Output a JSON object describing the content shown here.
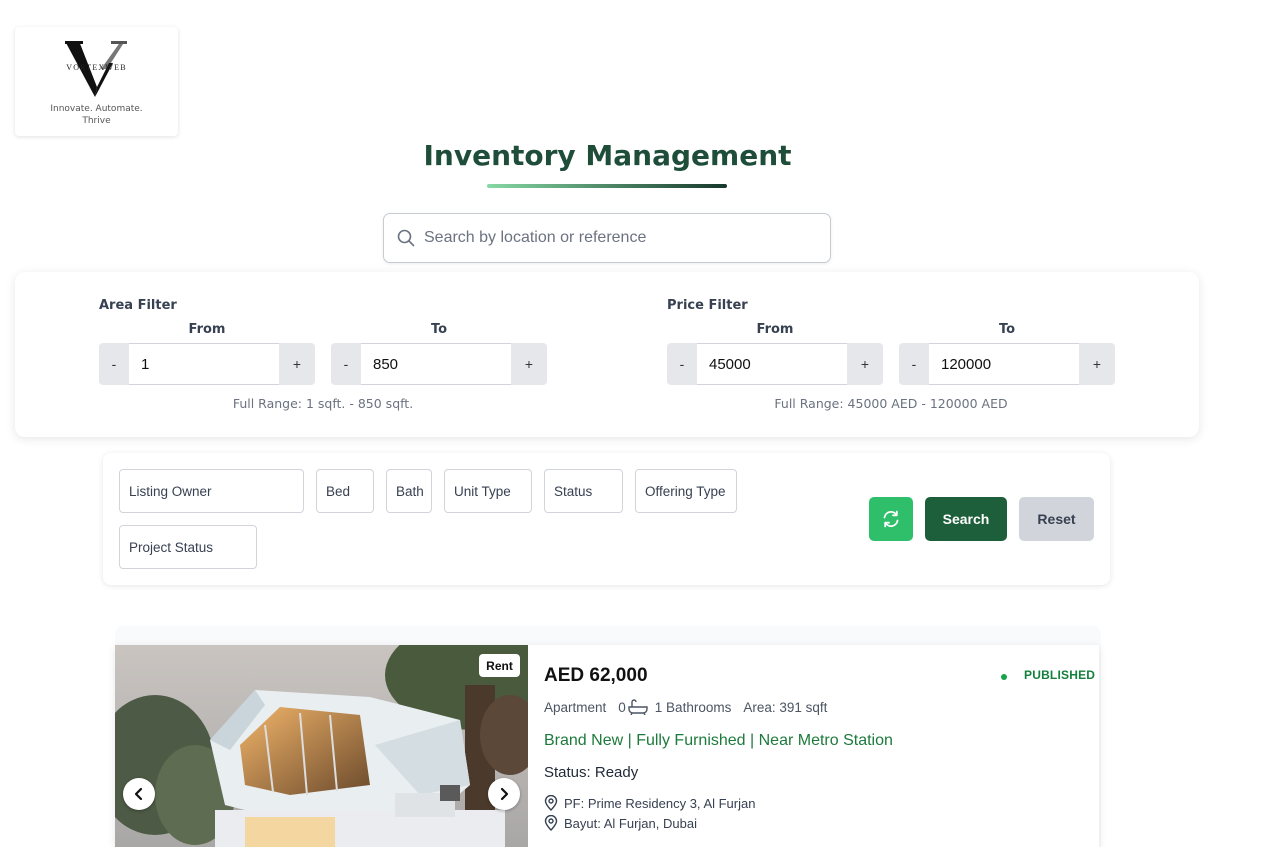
{
  "brand": {
    "name": "VORTEXWEB",
    "tagline": "Innovate. Automate. Thrive"
  },
  "header": {
    "title": "Inventory Management"
  },
  "search": {
    "placeholder": "Search by location or reference",
    "value": ""
  },
  "area_filter": {
    "title": "Area Filter",
    "from_label": "From",
    "to_label": "To",
    "from_value": "1",
    "to_value": "850",
    "range_note": "Full Range: 1 sqft. - 850 sqft."
  },
  "price_filter": {
    "title": "Price Filter",
    "from_label": "From",
    "to_label": "To",
    "from_value": "45000",
    "to_value": "120000",
    "range_note": "Full Range: 45000 AED - 120000 AED"
  },
  "stepper": {
    "minus": "-",
    "plus": "+"
  },
  "options": {
    "listing_owner": "Listing Owner",
    "bed": "Bed",
    "bath": "Bath",
    "unit_type": "Unit Type",
    "status": "Status",
    "offering_type": "Offering Type",
    "project_status": "Project Status"
  },
  "actions": {
    "search": "Search",
    "reset": "Reset"
  },
  "listing": {
    "tag": "Rent",
    "price": "AED 62,000",
    "status": "PUBLISHED",
    "type": "Apartment",
    "bedrooms": "0",
    "bathrooms": "1 Bathrooms",
    "area": "Area: 391 sqft",
    "headline": "Brand New | Fully Furnished | Near Metro Station",
    "project_status": "Status: Ready",
    "location_pf": "PF: Prime Residency 3, Al Furjan",
    "location_bayut": "Bayut: Al Furjan, Dubai"
  },
  "colors": {
    "title": "#1e4d3a",
    "primary": "#1d5f3a",
    "refresh": "#2fbf6b",
    "published": "#15803d"
  }
}
